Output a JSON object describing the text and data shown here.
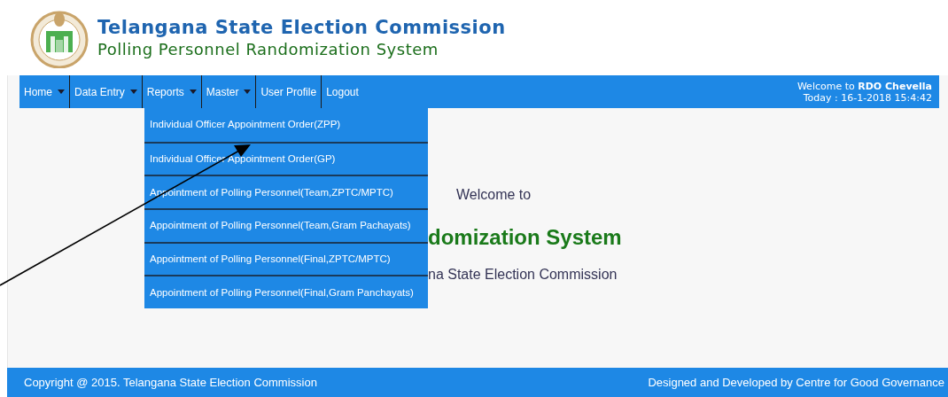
{
  "header": {
    "title": "Telangana State Election Commission",
    "subtitle": "Polling Personnel Randomization System"
  },
  "nav": [
    {
      "label": "Home",
      "caret": true,
      "expanded": false
    },
    {
      "label": "Data Entry",
      "caret": true,
      "expanded": false
    },
    {
      "label": "Reports",
      "caret": true,
      "expanded": true,
      "children": [
        {
          "label": "Individual Officer Appointment Order(ZPP)"
        },
        {
          "label": "Individual Officer Appointment Order(GP)"
        },
        {
          "label": "Appointment of Polling Personnel(Team,ZPTC/MPTC)"
        },
        {
          "label": "Appointment of Polling Personnel(Team,Gram Pachayats)"
        },
        {
          "label": "Appointment of Polling Personnel(Final,ZPTC/MPTC)"
        },
        {
          "label": "Appointment of Polling Personnel(Final,Gram Panchayats)"
        }
      ]
    },
    {
      "label": "Master",
      "caret": true,
      "expanded": false
    },
    {
      "label": "User Profile",
      "caret": false,
      "expanded": false
    },
    {
      "label": "Logout",
      "caret": false,
      "expanded": false
    }
  ],
  "user": {
    "welcome": "Welcome to **RDO Chevella**",
    "today": "Today : 16-1-2018 15:4:42"
  },
  "content": {
    "welcome": "Welcome to",
    "system": "domization System",
    "commission": "na State Election Commission"
  },
  "footer": {
    "copyright": "Copyright @ 2015. Telangana State Election Commission",
    "credits": "Designed and Developed by Centre for Good Governance"
  }
}
